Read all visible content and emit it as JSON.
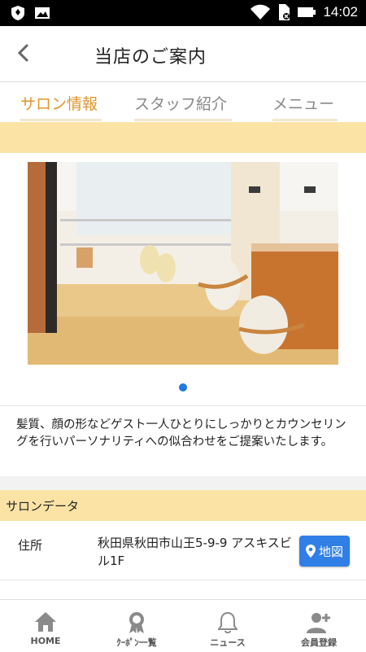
{
  "status_bar": {
    "time": "14:02",
    "icons": [
      "shield-icon",
      "image-icon",
      "wifi-icon",
      "sim-icon",
      "battery-icon"
    ]
  },
  "header": {
    "title": "当店のご案内"
  },
  "tabs": [
    {
      "label": "サロン情報",
      "active": true
    },
    {
      "label": "スタッフ紹介",
      "active": false
    },
    {
      "label": "メニュー",
      "active": false
    }
  ],
  "description": "髪質、顔の形などゲスト一人ひとりにしっかりとカウンセリングを行いパーソナリティへの似合わせをご提案いたします。",
  "salon_data": {
    "section_title": "サロンデータ",
    "address_label": "住所",
    "address_value": "秋田県秋田市山王5-9-9 アスキスビル1F",
    "map_button": "地図"
  },
  "bottom_nav": [
    {
      "label": "HOME",
      "icon": "home-icon"
    },
    {
      "label": "ｸｰﾎﾟﾝ一覧",
      "icon": "coupon-icon"
    },
    {
      "label": "ニュース",
      "icon": "bell-icon"
    },
    {
      "label": "会員登録",
      "icon": "add-user-icon"
    }
  ],
  "colors": {
    "accent": "#e0962e",
    "section_bg": "#fbe3a6",
    "map_button_bg": "#2f7fe6",
    "carousel_dot": "#1e7be0"
  }
}
